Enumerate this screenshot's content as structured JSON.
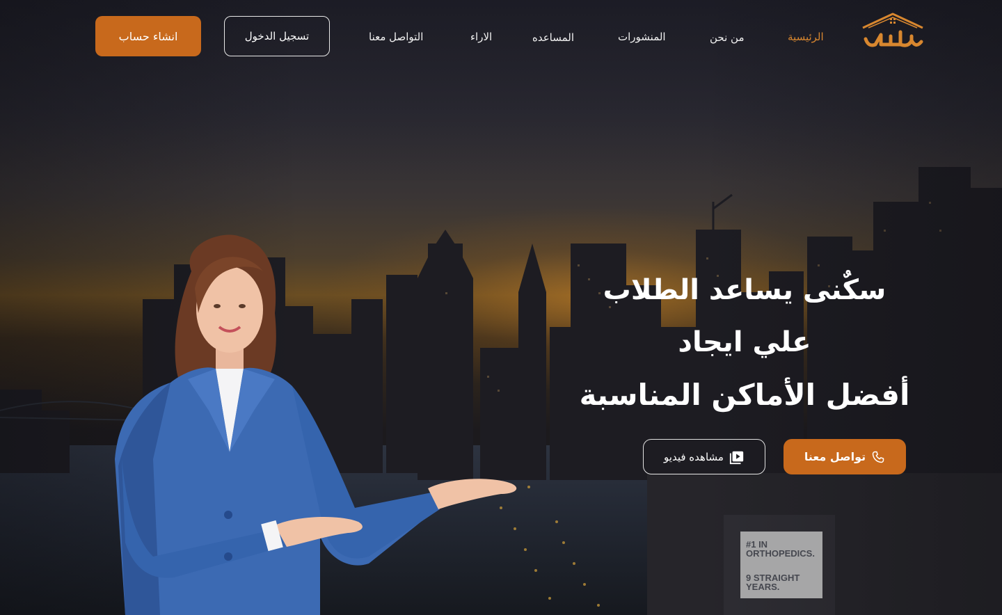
{
  "brand": {
    "logo_text": "سكنى",
    "accent_color": "#c8691c",
    "active_color": "#d8872f"
  },
  "nav": {
    "items": [
      {
        "label": "الرئيسية",
        "active": true
      },
      {
        "label": "من نحن",
        "active": false
      },
      {
        "label": "المنشورات",
        "active": false
      },
      {
        "label": "المساعده",
        "active": false
      },
      {
        "label": "الاراء",
        "active": false
      },
      {
        "label": "التواصل معنا",
        "active": false
      }
    ]
  },
  "auth": {
    "login_label": "تسجيل الدخول",
    "signup_label": "انشاء حساب"
  },
  "hero": {
    "title_line1": "سكٌنى يساعد الطلاب",
    "title_line2": "علي ايجاد",
    "title_line3": "أفضل الأماكن المناسبة",
    "contact_button": "تواصل معنا",
    "contact_icon": "phone-icon",
    "video_button": "مشاهده فيديو",
    "video_icon": "play-video-icon"
  },
  "billboard": {
    "line1": "#1 IN",
    "line2": "ORTHOPEDICS.",
    "line3": "9 STRAIGHT",
    "line4": "YEARS."
  }
}
